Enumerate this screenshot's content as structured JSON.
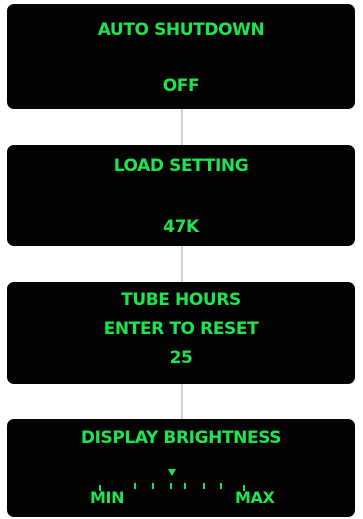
{
  "menu": {
    "auto_shutdown": {
      "title": "AUTO SHUTDOWN",
      "value": "OFF"
    },
    "load_setting": {
      "title": "LOAD SETTING",
      "value": "47K"
    },
    "tube_hours": {
      "title": "TUBE HOURS",
      "subtitle": "ENTER TO RESET",
      "value": "25"
    },
    "display_brightness": {
      "title": "DISPLAY BRIGHTNESS",
      "min_label": "MIN",
      "max_label": "MAX",
      "level_percent": 50
    }
  },
  "colors": {
    "display_text": "#1fe34f",
    "screen_background": "#030303",
    "connector": "#d0d0d0"
  }
}
